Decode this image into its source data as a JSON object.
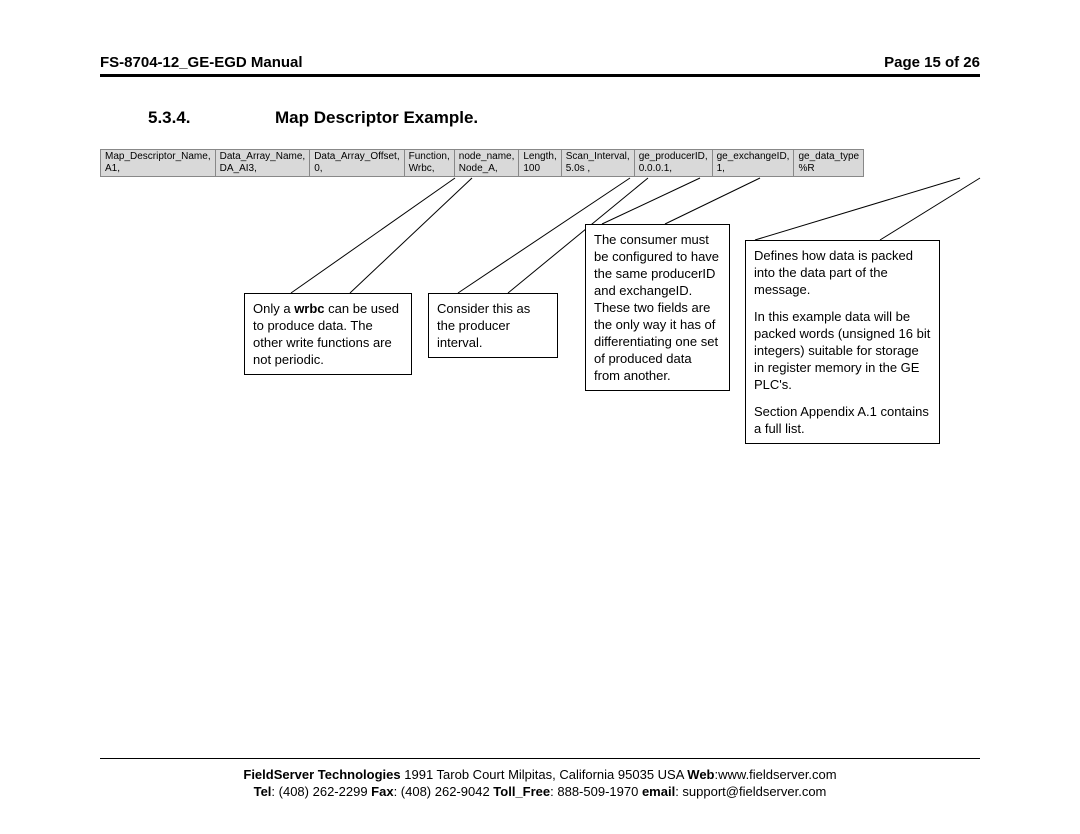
{
  "header": {
    "left": "FS-8704-12_GE-EGD Manual",
    "right": "Page 15 of 26"
  },
  "section": {
    "number": "5.3.4.",
    "title": "Map Descriptor Example."
  },
  "table": {
    "headers": [
      "Map_Descriptor_Name,",
      "Data_Array_Name,",
      "Data_Array_Offset,",
      "Function,",
      "node_name,",
      "Length,",
      "Scan_Interval,",
      "ge_producerID,",
      "ge_exchangeID,",
      "ge_data_type"
    ],
    "row": [
      "A1,",
      "DA_AI3,",
      "0,",
      "Wrbc,",
      "Node_A,",
      "100",
      "5.0s ,",
      "0.0.0.1,",
      "1,",
      "%R"
    ]
  },
  "callouts": {
    "c1_pre": "Only a ",
    "c1_bold": "wrbc",
    "c1_post": " can be used to produce data. The other write functions are not periodic.",
    "c2": "Consider this as the producer interval.",
    "c3": "The consumer must be configured to have the same producerID and exchangeID. These two fields are the only way it has of differentiating one set of produced data from another.",
    "c4a": "Defines how data is packed into the data part of the message.",
    "c4b": "In this example data will be packed words (unsigned 16 bit integers) suitable for storage in register memory in the GE PLC's.",
    "c4c": "Section Appendix A.1 contains a full list."
  },
  "footer": {
    "company_bold": "FieldServer Technologies",
    "addr": " 1991 Tarob Court Milpitas, California 95035 USA  ",
    "web_lbl": "Web",
    "web_val": ":www.fieldserver.com",
    "tel_lbl": "Tel",
    "tel_val": ": (408) 262-2299  ",
    "fax_lbl": "Fax",
    "fax_val": ": (408) 262-9042   ",
    "toll_lbl": "Toll_Free",
    "toll_val": ": 888-509-1970   ",
    "email_lbl": "email",
    "email_val": ": support@fieldserver.com"
  }
}
